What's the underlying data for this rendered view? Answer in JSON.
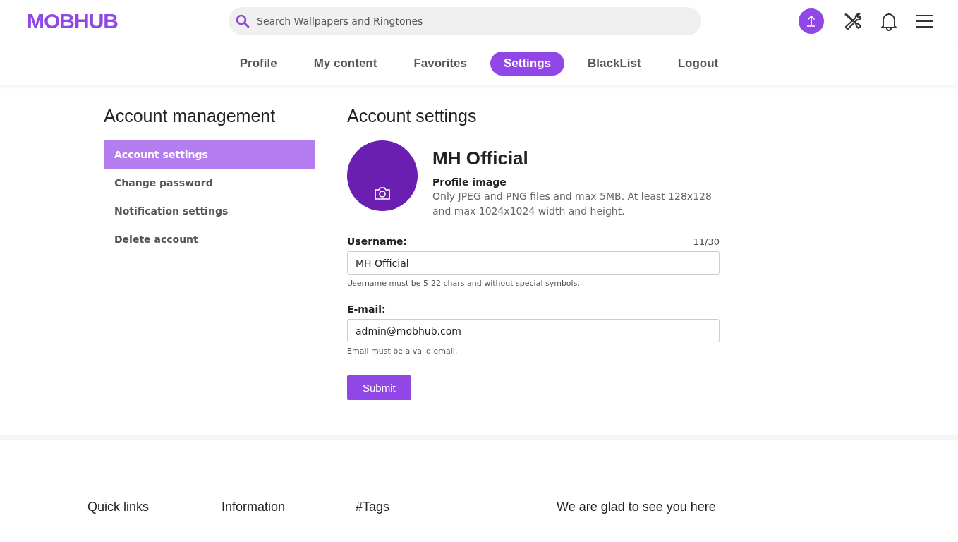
{
  "header": {
    "logo": "MOBHUB",
    "search": {
      "placeholder": "Search Wallpapers and Ringtones"
    }
  },
  "tabs": [
    {
      "label": "Profile",
      "selected": false
    },
    {
      "label": "My content",
      "selected": false
    },
    {
      "label": "Favorites",
      "selected": false
    },
    {
      "label": "Settings",
      "selected": true
    },
    {
      "label": "BlackList",
      "selected": false
    },
    {
      "label": "Logout",
      "selected": false
    }
  ],
  "sidebar": {
    "title": "Account management",
    "items": [
      {
        "label": "Account settings",
        "selected": true
      },
      {
        "label": "Change password",
        "selected": false
      },
      {
        "label": "Notification settings",
        "selected": false
      },
      {
        "label": "Delete account",
        "selected": false
      }
    ]
  },
  "main": {
    "title": "Account settings",
    "profile_name": "MH Official",
    "image_label": "Profile image",
    "image_hint": "Only JPEG and PNG files and max 5MB. At least 128x128 and max 1024x1024 width and height.",
    "fields": [
      {
        "label": "Username:",
        "counter": "11/30",
        "value": "MH Official",
        "hint": "Username must be 5-22 chars and without special symbols."
      },
      {
        "label": "E-mail:",
        "value": "admin@mobhub.com",
        "hint": "Email must be a valid email."
      }
    ],
    "submit": "Submit"
  },
  "footer": {
    "headings": [
      "Quick links",
      "Information",
      "#Tags",
      "We are glad to see you here"
    ]
  }
}
